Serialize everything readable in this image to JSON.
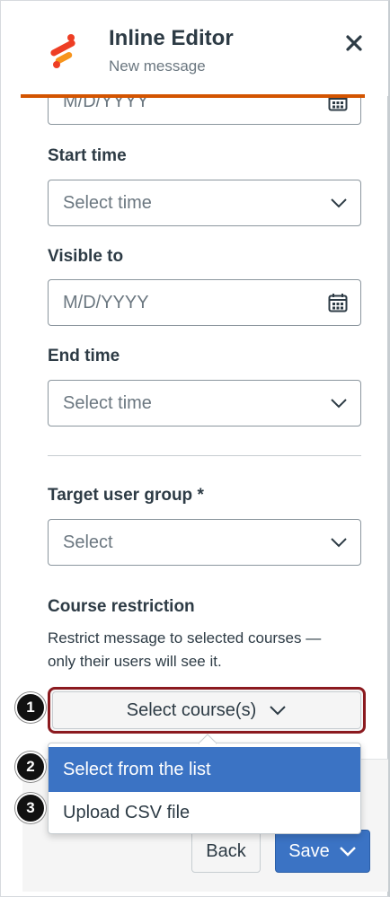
{
  "header": {
    "title": "Inline Editor",
    "subtitle": "New message",
    "close_icon": "close-icon",
    "brand_color": "#ee3e24",
    "accent_rule_color": "#d35400"
  },
  "form": {
    "visible_from_placeholder": "M/D/YYYY",
    "start_time_label": "Start time",
    "start_time_placeholder": "Select time",
    "visible_to_label": "Visible to",
    "visible_to_placeholder": "M/D/YYYY",
    "end_time_label": "End time",
    "end_time_placeholder": "Select time",
    "target_group_label": "Target user group *",
    "target_group_placeholder": "Select",
    "course_restriction_title": "Course restriction",
    "course_restriction_help": "Restrict message to selected courses — only their users will see it.",
    "select_courses_label": "Select course(s)"
  },
  "dropdown": {
    "items": [
      {
        "label": "Select from the list",
        "highlighted": true
      },
      {
        "label": "Upload CSV file",
        "highlighted": false
      }
    ]
  },
  "footer": {
    "back_label": "Back",
    "save_label": "Save"
  },
  "callouts": [
    "1",
    "2",
    "3"
  ],
  "colors": {
    "primary": "#3b73c4",
    "focus_ring": "#8b1a1f",
    "text": "#2d3b45",
    "muted": "#6b7780"
  }
}
